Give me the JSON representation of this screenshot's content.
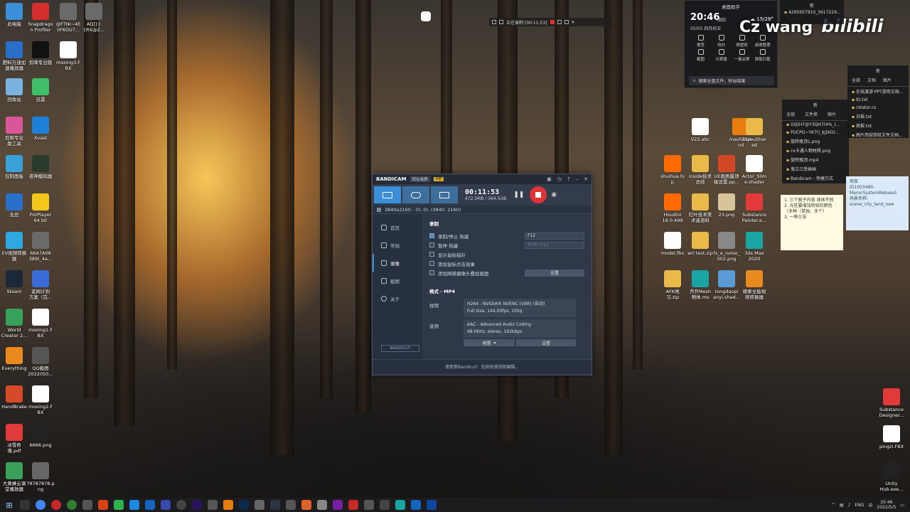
{
  "desktop_left": [
    {
      "label": "此电脑",
      "icon": "pc-icon",
      "color": "#3a8fd6"
    },
    {
      "label": "Snapdrago\nn Profiler",
      "icon": "snapdragon-icon",
      "color": "#d62d2d"
    },
    {
      "label": "@FTNI~4E\n0F6DU7...",
      "icon": "file-icon",
      "color": "#6a6a6a"
    },
    {
      "label": "AQ]}}\n{RX@Z...",
      "icon": "file-icon",
      "color": "#6a6a6a"
    },
    {
      "label": "肥料万速加\n速播放器",
      "icon": "app-icon",
      "color": "#2a6fc9"
    },
    {
      "label": "剪映专业版",
      "icon": "capcut-icon",
      "color": "#111111"
    },
    {
      "label": "moxing3.F\nBX",
      "icon": "fbx-icon",
      "color": "#ffffff"
    },
    {
      "label": "回收站",
      "icon": "recycle-bin-icon",
      "color": "#7ab3e0"
    },
    {
      "label": "迅雷",
      "icon": "xunlei-icon",
      "color": "#3fbf6a"
    },
    {
      "label": "剪映专业\n版工具",
      "icon": "app-icon",
      "color": "#d9569b"
    },
    {
      "label": "Xvast",
      "icon": "xvast-icon",
      "color": "#1d7fd8"
    },
    {
      "label": "控制面板",
      "icon": "control-panel-icon",
      "color": "#3aa0d8"
    },
    {
      "label": "夜神模拟器",
      "icon": "nox-icon",
      "color": "#2b3b2b"
    },
    {
      "label": "无忌",
      "icon": "app-icon",
      "color": "#2a6fc9"
    },
    {
      "label": "PotPlayer\n64 bit",
      "icon": "potplayer-icon",
      "color": "#f2c81a"
    },
    {
      "label": "EV视频转换\n器",
      "icon": "ev-icon",
      "color": "#2ea8e0"
    },
    {
      "label": "66A7A08\n389(_4a...",
      "icon": "file-icon",
      "color": "#6a6a6a"
    },
    {
      "label": "Steam",
      "icon": "steam-icon",
      "color": "#1b2838"
    },
    {
      "label": "蓝网计划\n方案（完...",
      "icon": "doc-icon",
      "color": "#3a6ad6"
    },
    {
      "label": "World\nCreator 2...",
      "icon": "world-creator-icon",
      "color": "#37a05a"
    },
    {
      "label": "moxing1.F\nBX",
      "icon": "fbx-icon",
      "color": "#ffffff"
    },
    {
      "label": "Everything",
      "icon": "everything-icon",
      "color": "#e98a1f"
    },
    {
      "label": "QQ截图\n2022050...",
      "icon": "image-icon",
      "color": "#555555"
    },
    {
      "label": "HandBrake",
      "icon": "handbrake-icon",
      "color": "#d64a2a"
    },
    {
      "label": "moxing2.F\nBX",
      "icon": "fbx-icon",
      "color": "#ffffff"
    },
    {
      "label": "冰雪奇\n缘.pdf",
      "icon": "pdf-icon",
      "color": "#e03a3a"
    },
    {
      "label": "6666.png",
      "icon": "image-icon",
      "color": "#222222"
    },
    {
      "label": "大黄蜂云课\n堂播放器",
      "icon": "player-icon",
      "color": "#3aa05a"
    },
    {
      "label": "78787878.p\nng",
      "icon": "image-icon",
      "color": "#666666"
    }
  ],
  "desktop_right": [
    {
      "label": "V22.abc",
      "icon": "file-icon",
      "color": "#ffffff"
    },
    {
      "label": "maofa.ble\nnd",
      "icon": "blender-icon",
      "color": "#e87d0d"
    },
    {
      "label": "ToyouShar\ned",
      "icon": "folder-icon",
      "color": "#e9b94a"
    },
    {
      "label": "shuihua.hi\np",
      "icon": "houdini-icon",
      "color": "#ff6a00"
    },
    {
      "label": "inside技术\n总结",
      "icon": "folder-icon",
      "color": "#e9b94a"
    },
    {
      "label": "UE画质最顶\n级设置.pp...",
      "icon": "ppt-icon",
      "color": "#d24726"
    },
    {
      "label": "Actor_Slim\ne.shader",
      "icon": "file-icon",
      "color": "#ffffff"
    },
    {
      "label": "Houdini\n18.0.499",
      "icon": "houdini-icon",
      "color": "#ff6a00"
    },
    {
      "label": "红叶技术美\n术遥资料",
      "icon": "folder-icon",
      "color": "#e9b94a"
    },
    {
      "label": "23.png",
      "icon": "image-icon",
      "color": "#d8c49a"
    },
    {
      "label": "Substance\nPainter.e...",
      "icon": "substance-icon",
      "color": "#e23a3a"
    },
    {
      "label": "model.fbx",
      "icon": "fbx-icon",
      "color": "#ffffff"
    },
    {
      "label": "wrl test.zip",
      "icon": "zip-icon",
      "color": "#e9b94a"
    },
    {
      "label": "fx_a_noise_\n002.png",
      "icon": "image-icon",
      "color": "#888888"
    },
    {
      "label": "3ds Max\n2020",
      "icon": "3dsmax-icon",
      "color": "#1aa5a5"
    },
    {
      "label": "AFK地\n习.zip",
      "icon": "zip-icon",
      "color": "#e9b94a"
    },
    {
      "label": "乔开Mesh\n物体.ms",
      "icon": "maxscript-icon",
      "color": "#1aa5a5"
    },
    {
      "label": "tongdaopi\nanyi.shad...",
      "icon": "file-icon",
      "color": "#5a9bd6"
    },
    {
      "label": "搜索全能视\n频转换器",
      "icon": "converter-icon",
      "color": "#e98a1f"
    },
    {
      "label": "Substance\nDesigner...",
      "icon": "substance-icon",
      "color": "#e23a3a"
    },
    {
      "label": "pingzi.FBX",
      "icon": "fbx-icon",
      "color": "#ffffff"
    },
    {
      "label": "Unity\nHub.exe...",
      "icon": "unity-icon",
      "color": "#222222"
    }
  ],
  "recording_bar": {
    "status": "正在录制 [00:11:53]"
  },
  "bandicam": {
    "logo": "BANDICAM",
    "tag": "现在录屏",
    "vip": "VIP",
    "timer": "00:11:53",
    "size": "472.5MB / 364.5GB",
    "area": "3840x2160 - (0, 0), (3840, 2160)",
    "sidebar": [
      "首页",
      "常规",
      "录像",
      "截图",
      "关于"
    ],
    "bandicut": "BANDICUT",
    "section_record": "录制",
    "rows": [
      {
        "label": "录制/停止 热键",
        "checked": true,
        "right": "F12"
      },
      {
        "label": "暂停 热键",
        "checked": false,
        "right": "Shift+F12"
      },
      {
        "label": "显示鼠标指针",
        "checked": false,
        "right": ""
      },
      {
        "label": "添加鼠标点击效果",
        "checked": false,
        "right": ""
      },
      {
        "label": "添加网络摄像头叠加画面",
        "checked": false,
        "right": ""
      }
    ],
    "settings_btn": "设置",
    "section_format": "格式 - MP4",
    "video_label": "视频",
    "video_line1": "H264 - NVIDIA® NVENC (VBR) (自动)",
    "video_line2": "Full Size, 144.00fps, 100q",
    "audio_label": "音频",
    "audio_line1": "AAC - Advanced Audio Coding",
    "audio_line2": "48.0KHz, stereo, 192kbps",
    "preset_btn": "预置",
    "settings_btn2": "设置",
    "footer": "请使用Bandicut！无损快速视频编辑。"
  },
  "assistant": {
    "header": "桌面助手",
    "time": "20:46",
    "dow": "周四",
    "date": "05/05 四月初五",
    "weather": "15/28°",
    "grid": [
      "便签",
      "待办",
      "换壁纸",
      "桌面整理",
      "截图",
      "计算器",
      "一键关屏",
      "弹窗拦截"
    ],
    "search": "搜索全盘文件，秒出结果"
  },
  "brand": {
    "left": "Cz wang",
    "right": "bilibili"
  },
  "panel_new1": {
    "title": "新",
    "items": [
      "4295657910_3617229...",
      "全部",
      "文件夹",
      "图片"
    ]
  },
  "panel_files": {
    "title": "新",
    "tabs": [
      "全部",
      "文件夹",
      "图片"
    ],
    "files": [
      "GQ[H7@Y3QH7(4%_)...",
      "PUCPG~YK7(l_$J[6O)...",
      "旋转瓶顶1.png",
      "cx卡通人物材质.png",
      "旋转瓶顶.mp4",
      "鬼泣三受插画",
      "Bandicam - 快捷方式"
    ]
  },
  "panel_right": {
    "title": "新",
    "tabs": [
      "全部",
      "文档",
      "图片"
    ],
    "files": [
      "在线渡游·PPT游用文档...",
      "ID.txt",
      "rotator.cs",
      "日报.txt",
      "周报.txt",
      "图片西捏捞给文件文档..."
    ]
  },
  "note_yellow": {
    "text": "1. 三个瓶子内容 液体不同\n2. 光柱要增加特效的颜色（多种（单独、多个）\n3. 一种三张"
  },
  "note_blue": {
    "text": "项目\nID1003480-\nManorSystemRebase1\n场景名称:\nscene_city_land_new"
  },
  "tray": {
    "lang": "ENG",
    "lang2": "中",
    "time": "20:46",
    "date": "2022/5/5"
  }
}
